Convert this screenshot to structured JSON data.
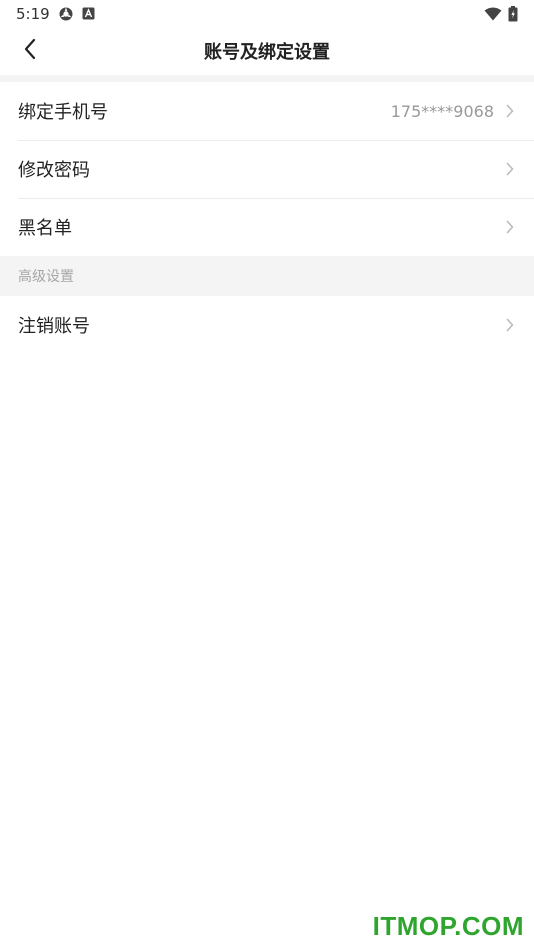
{
  "status_bar": {
    "time": "5:19",
    "icons": [
      "settings-gear-icon",
      "keyboard-a-icon",
      "wifi-icon",
      "battery-icon"
    ]
  },
  "header": {
    "title": "账号及绑定设置",
    "back_icon": "chevron-left-icon"
  },
  "list": {
    "items": [
      {
        "label": "绑定手机号",
        "value": "175****9068"
      },
      {
        "label": "修改密码",
        "value": ""
      },
      {
        "label": "黑名单",
        "value": ""
      }
    ],
    "advanced_section_title": "高级设置",
    "advanced_items": [
      {
        "label": "注销账号"
      }
    ]
  },
  "watermark": "ITMOP.COM",
  "colors": {
    "background": "#ffffff",
    "divider": "#f4f4f4",
    "muted_text": "#999999",
    "watermark": "#2fa52f"
  }
}
